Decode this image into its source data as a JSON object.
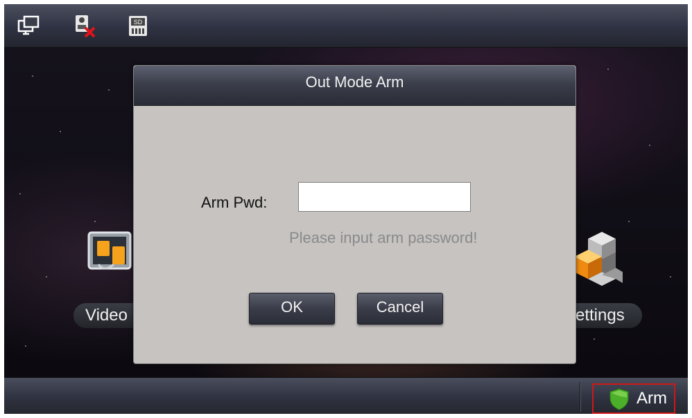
{
  "topbar": {
    "icons": [
      "monitor-icon",
      "sd-card-error-icon",
      "sd-card-icon"
    ],
    "sd_label": "SD"
  },
  "desktop": {
    "apps": [
      {
        "name": "video-talk-app",
        "label": "Video",
        "icon": "video-talk-icon"
      },
      {
        "name": "settings-app",
        "label": "ettings",
        "icon": "settings-cubes-icon"
      }
    ]
  },
  "dialog": {
    "title": "Out Mode Arm",
    "pwd_label": "Arm Pwd:",
    "pwd_value": "",
    "hint": "Please input arm password!",
    "ok_label": "OK",
    "cancel_label": "Cancel"
  },
  "bottombar": {
    "arm_label": "Arm",
    "arm_icon": "shield-icon",
    "arm_highlight_color": "#d01818",
    "shield_color": "#4caf2a"
  }
}
